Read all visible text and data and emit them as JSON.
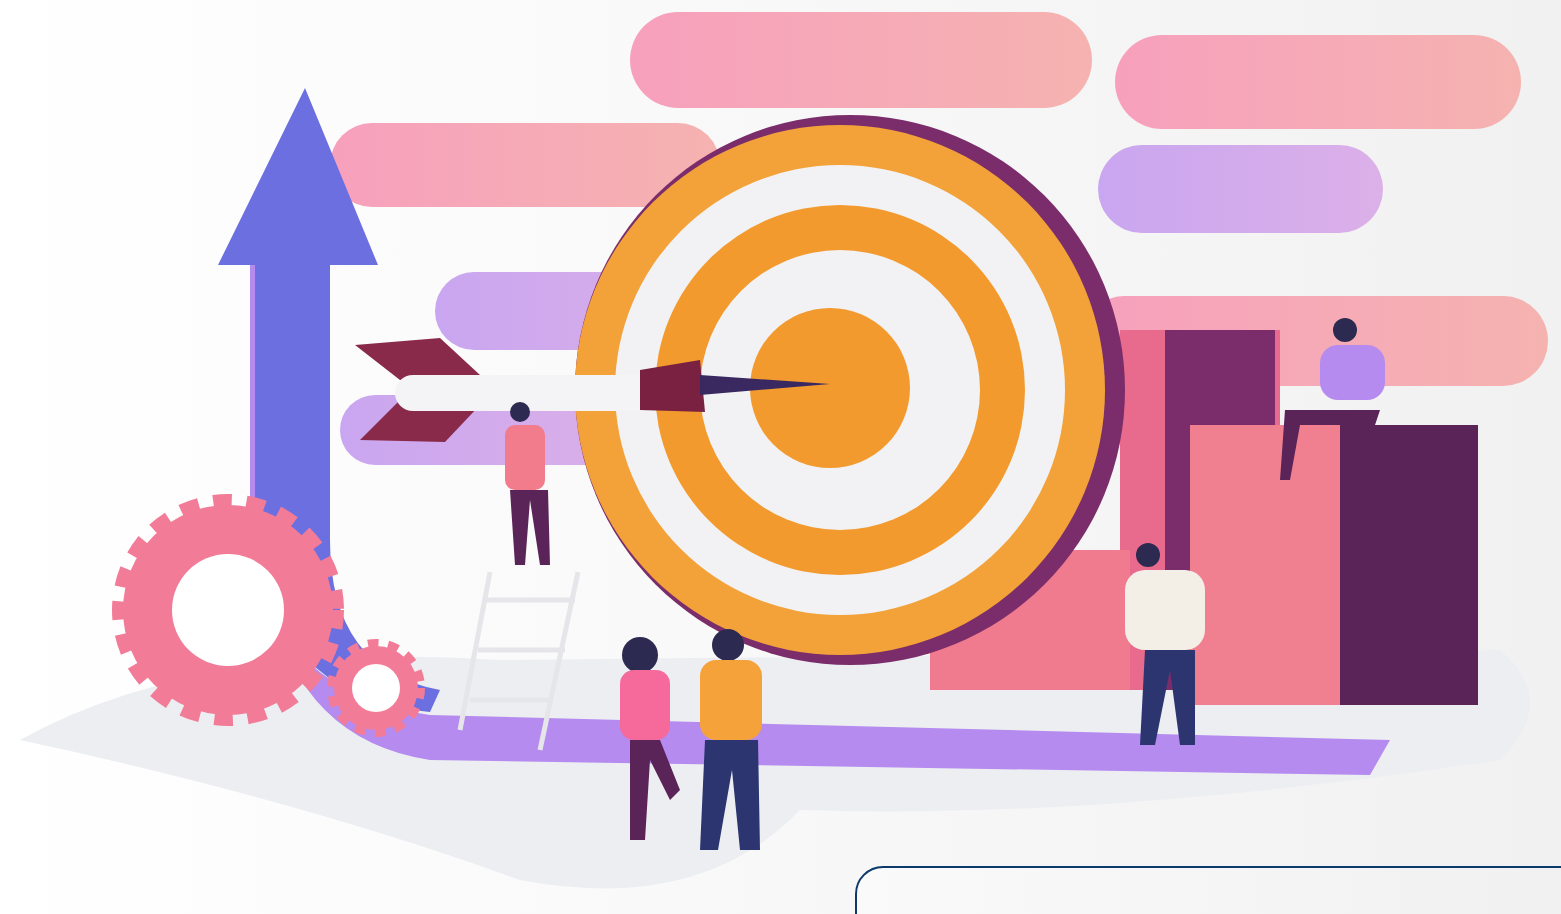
{
  "hero_illustration": {
    "shown": true
  },
  "info_card": {
    "shown": true
  }
}
